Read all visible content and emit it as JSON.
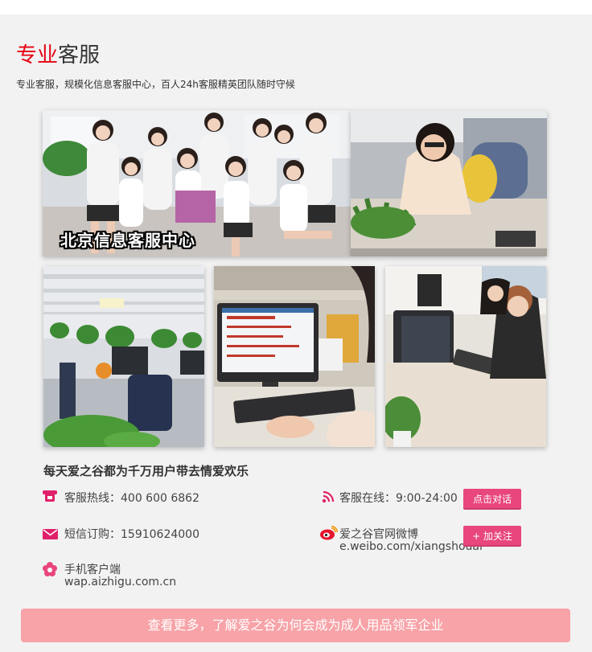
{
  "section": {
    "title_red": "专业",
    "title_black": "客服",
    "subtitle": "专业客服，规模化信息客服中心，百人24h客服精英团队随时守候"
  },
  "photos": {
    "main_caption": "北京信息客服中心"
  },
  "slogan": "每天爱之谷都为千万用户带去情爱欢乐",
  "contact": {
    "hotline": "客服热线：400 600  6862",
    "online": "客服在线：9:00-24:00",
    "chat_button": "点击对话",
    "sms": "短信订购：15910624000",
    "weibo_label": "爱之谷官网微博",
    "weibo_url": "e.weibo.com/xiangshouai",
    "follow_button": "+ 加关注",
    "mobile_label": "手机客户端",
    "mobile_url": "wap.aizhigu.com.cn"
  },
  "cta": "查看更多，了解爱之谷为何会成为成人用品领军企业",
  "colors": {
    "accent_red": "#e60012",
    "button_pink": "#e8467c",
    "cta_pink": "#f7a3a8"
  },
  "icons": [
    "phone-icon",
    "wifi-signal-icon",
    "envelope-icon",
    "weibo-icon",
    "flower-icon"
  ]
}
